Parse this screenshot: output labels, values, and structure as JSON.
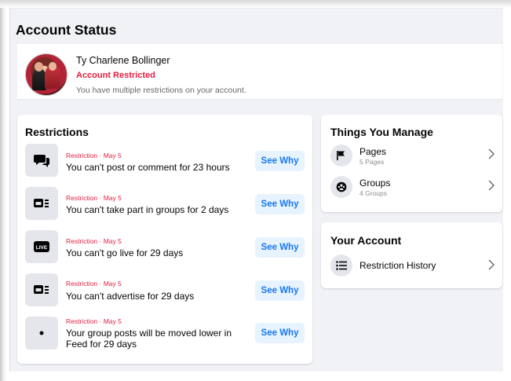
{
  "page": {
    "title": "Account Status"
  },
  "account": {
    "name": "Ty Charlene Bollinger",
    "status": "Account Restricted",
    "description": "You have multiple restrictions on your account."
  },
  "restrictions": {
    "title": "Restrictions",
    "items": [
      {
        "meta": "Restriction · May 5",
        "text": "You can't post or comment for 23 hours",
        "icon": "comment-icon",
        "button": "See Why"
      },
      {
        "meta": "Restriction · May 5",
        "text": "You can't take part in groups for 2 days",
        "icon": "group-feed-icon",
        "button": "See Why"
      },
      {
        "meta": "Restriction · May 5",
        "text": "You can't go live for 29 days",
        "icon": "live-icon",
        "button": "See Why"
      },
      {
        "meta": "Restriction · May 5",
        "text": "You can't advertise for 29 days",
        "icon": "ad-icon",
        "button": "See Why"
      },
      {
        "meta": "Restriction · May 5",
        "text": "Your group posts will be moved lower in Feed for 29 days",
        "icon": "dot-icon",
        "button": "See Why"
      }
    ]
  },
  "manage": {
    "title": "Things You Manage",
    "items": [
      {
        "label": "Pages",
        "sub": "5 Pages",
        "icon": "flag-icon"
      },
      {
        "label": "Groups",
        "sub": "4 Groups",
        "icon": "groups-icon"
      }
    ]
  },
  "your_account": {
    "title": "Your Account",
    "items": [
      {
        "label": "Restriction History",
        "icon": "list-icon"
      }
    ]
  },
  "colors": {
    "accent": "#1877f2",
    "danger": "#e41e3f",
    "button_bg": "#e7f3ff",
    "page_bg": "#f0f2f5"
  }
}
